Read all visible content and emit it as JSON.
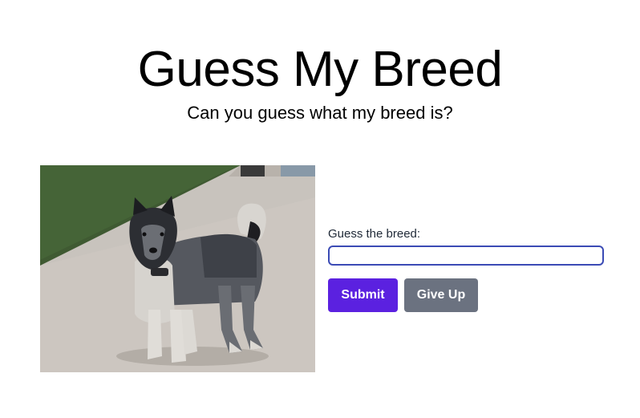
{
  "header": {
    "title": "Guess My Breed",
    "subtitle": "Can you guess what my breed is?"
  },
  "photo": {
    "icon": "dog-photo"
  },
  "form": {
    "label": "Guess the breed:",
    "input_value": "",
    "submit_label": "Submit",
    "giveup_label": "Give Up"
  },
  "colors": {
    "submit_button": "#5b21e0",
    "giveup_button": "#6b7280",
    "input_border": "#3b4bb5"
  }
}
